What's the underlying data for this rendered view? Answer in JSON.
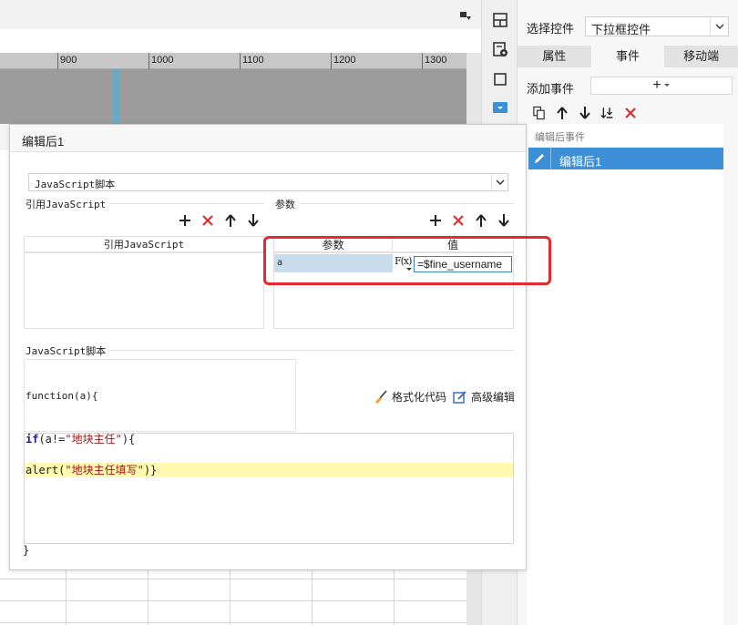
{
  "ruler": {
    "labels": [
      "900",
      "1000",
      "1100",
      "1200",
      "1300"
    ]
  },
  "right_panel": {
    "select_control_label": "选择控件",
    "select_control_value": "下拉框控件",
    "tabs": [
      {
        "label": "属性"
      },
      {
        "label": "事件"
      },
      {
        "label": "移动端"
      }
    ],
    "active_tab": "事件",
    "add_event_label": "添加事件",
    "add_event_icon": "+",
    "event_list_header": "编辑后事件",
    "event_item": "编辑后1"
  },
  "dialog": {
    "title": "编辑后1",
    "js_type": "JavaScript脚本",
    "ref_section_title": "引用JavaScript",
    "ref_table_header": "引用JavaScript",
    "param_section_title": "参数",
    "param_table": {
      "col_param": "参数",
      "col_value": "值",
      "rows": [
        {
          "name": "a",
          "fx": "F(x)",
          "value": "=$fine_username"
        }
      ]
    },
    "script_section_title": "JavaScript脚本",
    "function_signature": "function(a){",
    "format_code_label": "格式化代码",
    "advanced_edit_label": "高级编辑",
    "code": {
      "line1_kw": "if",
      "line1_pre": "(a!=",
      "line1_str": "\"地块主任\"",
      "line1_post": "){",
      "line2_pre": "alert(",
      "line2_str": "\"地块主任填写\"",
      "line2_post": ")}"
    },
    "closing_brace": "}"
  },
  "colors": {
    "accent_blue": "#3d8fd7",
    "delete_red": "#e03030",
    "highlight_red": "#e8272f",
    "line_highlight": "#fffab0",
    "param_cell": "#c8dced"
  }
}
